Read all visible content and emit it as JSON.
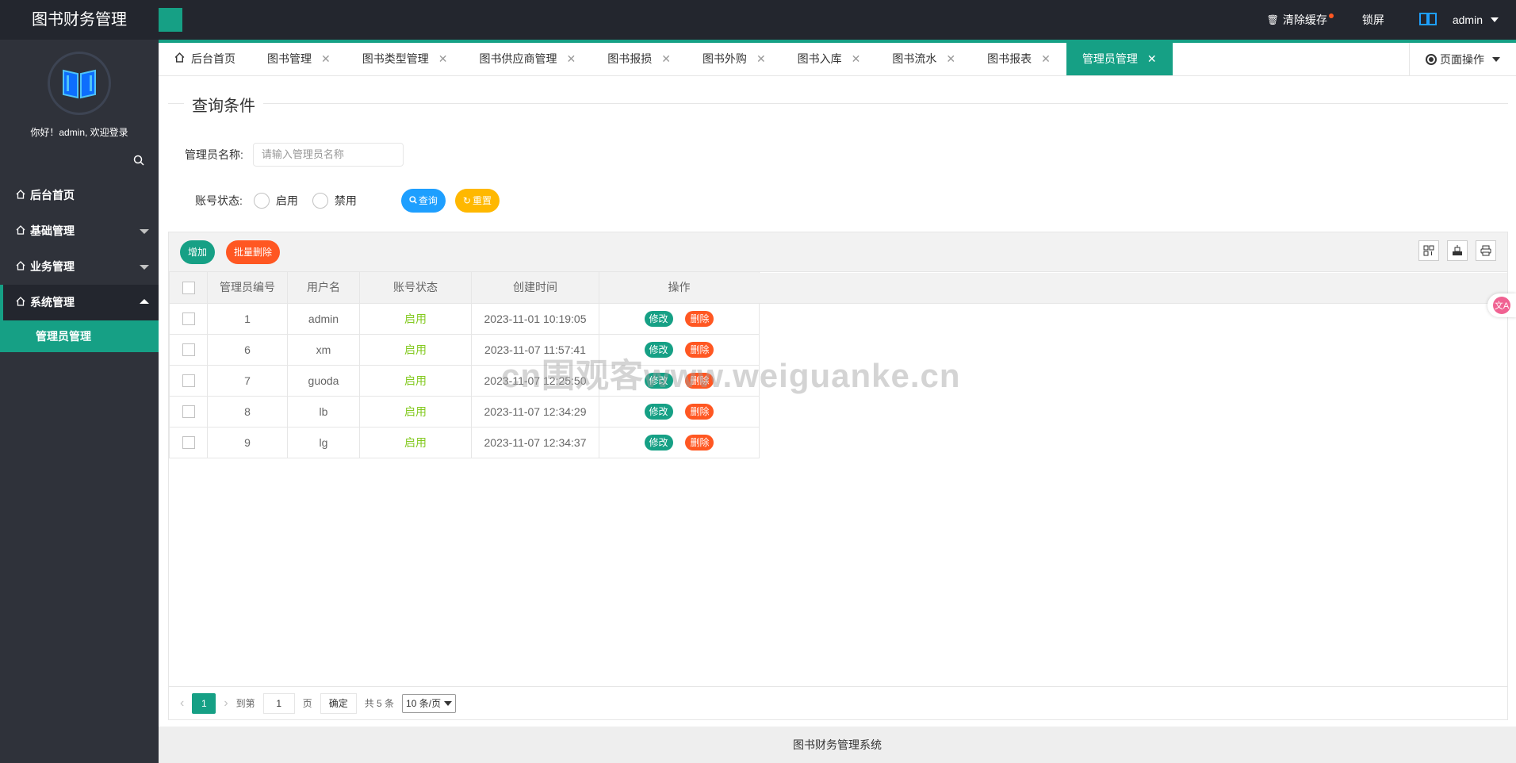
{
  "app": {
    "title": "图书财务管理",
    "footer": "图书财务管理系统"
  },
  "header": {
    "clear_cache": "清除缓存",
    "lock_screen": "锁屏",
    "user": "admin"
  },
  "sidebar": {
    "welcome": "你好！admin, 欢迎登录",
    "items": [
      {
        "label": "后台首页"
      },
      {
        "label": "基础管理"
      },
      {
        "label": "业务管理"
      },
      {
        "label": "系统管理"
      }
    ],
    "sub_item": "管理员管理"
  },
  "tabs": [
    {
      "label": "后台首页"
    },
    {
      "label": "图书管理"
    },
    {
      "label": "图书类型管理"
    },
    {
      "label": "图书供应商管理"
    },
    {
      "label": "图书报损"
    },
    {
      "label": "图书外购"
    },
    {
      "label": "图书入库"
    },
    {
      "label": "图书流水"
    },
    {
      "label": "图书报表"
    },
    {
      "label": "管理员管理"
    }
  ],
  "tab_ops": "页面操作",
  "query": {
    "legend": "查询条件",
    "name_label": "管理员名称:",
    "name_placeholder": "请输入管理员名称",
    "status_label": "账号状态:",
    "status_enable": "启用",
    "status_disable": "禁用",
    "search_btn": "查询",
    "reset_btn": "重置"
  },
  "toolbar": {
    "add": "增加",
    "batch_delete": "批量删除"
  },
  "table": {
    "columns": [
      "管理员编号",
      "用户名",
      "账号状态",
      "创建时间",
      "操作"
    ],
    "rows": [
      {
        "id": "1",
        "username": "admin",
        "status": "启用",
        "created": "2023-11-01 10:19:05"
      },
      {
        "id": "6",
        "username": "xm",
        "status": "启用",
        "created": "2023-11-07 11:57:41"
      },
      {
        "id": "7",
        "username": "guoda",
        "status": "启用",
        "created": "2023-11-07 12:25:50"
      },
      {
        "id": "8",
        "username": "lb",
        "status": "启用",
        "created": "2023-11-07 12:34:29"
      },
      {
        "id": "9",
        "username": "lg",
        "status": "启用",
        "created": "2023-11-07 12:34:37"
      }
    ],
    "edit": "修改",
    "delete": "删除"
  },
  "pager": {
    "current": "1",
    "goto": "到第",
    "page_value": "1",
    "page_unit": "页",
    "confirm": "确定",
    "total": "共 5 条",
    "per_page": "10 条/页"
  },
  "watermark": "cn围观客www.weiguanke.cn",
  "colors": {
    "accent": "#16a085",
    "header_bg": "#23262e",
    "sidebar_bg": "#2f323a",
    "blue": "#1e9fff",
    "yellow": "#ffb800",
    "red": "#ff5722"
  }
}
